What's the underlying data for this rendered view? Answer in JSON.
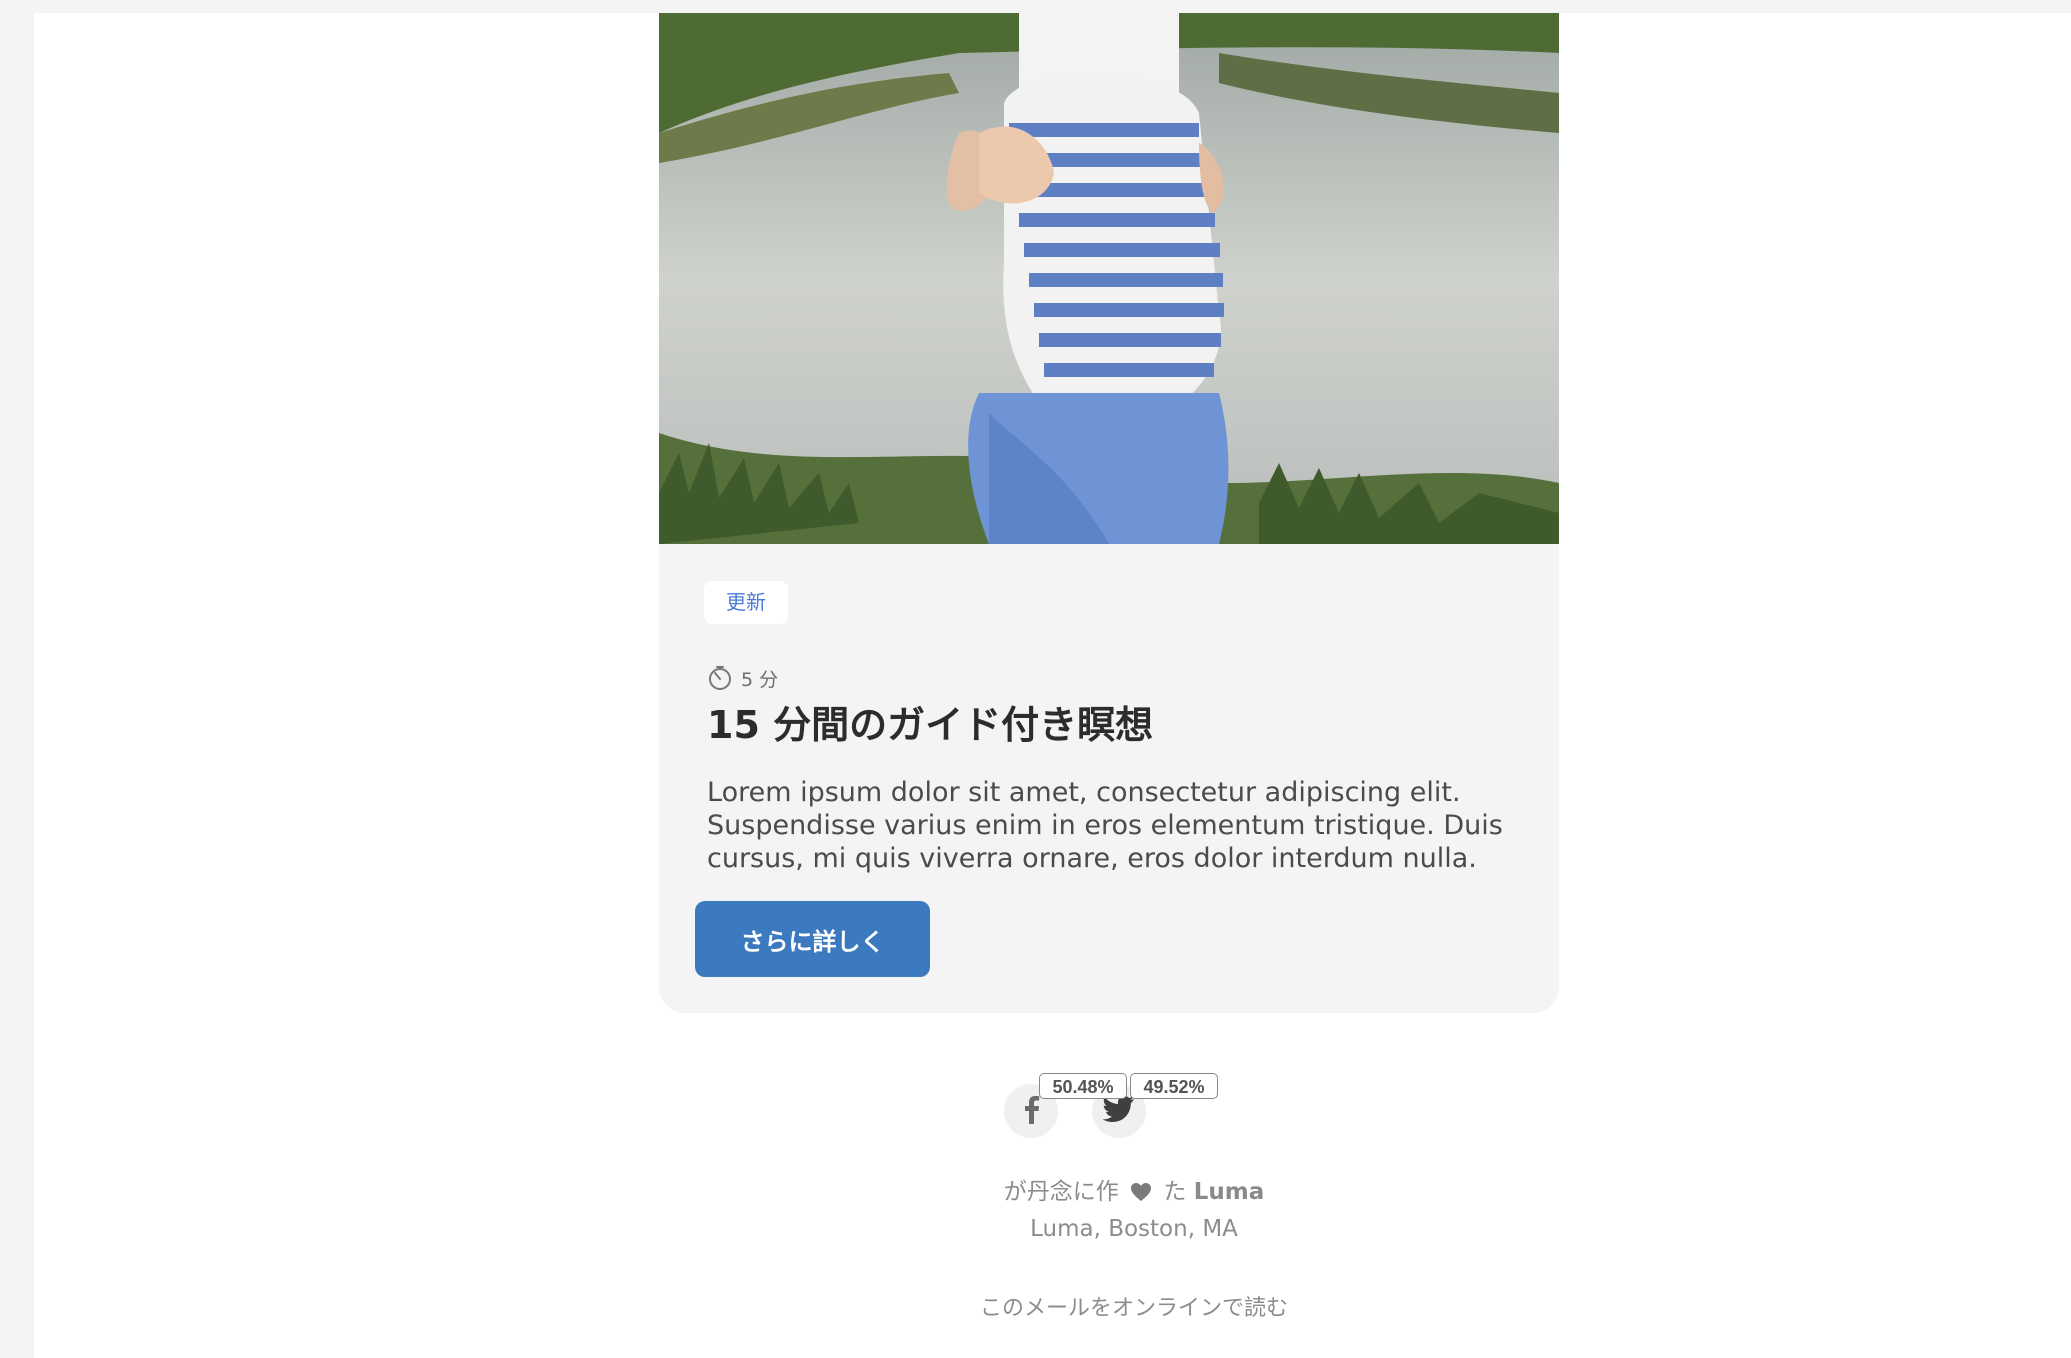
{
  "card": {
    "tag": "更新",
    "duration": "5 分",
    "title": "15 分間のガイド付き瞑想",
    "body": "Lorem ipsum dolor sit amet, consectetur adipiscing elit. Suspendisse varius enim in eros elementum tristique. Duis cursus, mi quis viverra ornare, eros dolor interdum nulla.",
    "cta_label": "さらに詳しく"
  },
  "social": {
    "facebook_pct": "50.48%",
    "twitter_pct": "49.52%"
  },
  "footer": {
    "made_prefix": "が丹念に作",
    "made_mid": "た",
    "brand": "Luma",
    "address": "Luma, Boston, MA",
    "read_online": "このメールをオンラインで読む"
  },
  "colors": {
    "accent": "#3c7ac0",
    "tag_text": "#4a7ad8",
    "card_bg": "#f4f4f4"
  },
  "icons": {
    "timer": "stopwatch-icon",
    "facebook": "facebook-icon",
    "twitter": "twitter-icon",
    "heart": "heart-icon"
  }
}
